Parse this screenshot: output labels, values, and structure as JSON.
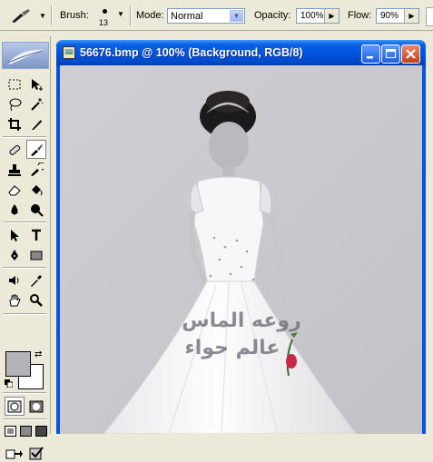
{
  "options_bar": {
    "brush_label": "Brush:",
    "brush_size": "13",
    "mode_label": "Mode:",
    "mode_value": "Normal",
    "opacity_label": "Opacity:",
    "opacity_value": "100%",
    "flow_label": "Flow:",
    "flow_value": "90%"
  },
  "toolbox": {
    "foreground_color": "#b4b4b8",
    "background_color": "#ffffff",
    "tools": [
      "marquee",
      "move",
      "lasso",
      "magic-wand",
      "crop",
      "slice",
      "healing-brush",
      "brush",
      "clone-stamp",
      "history-brush",
      "eraser",
      "paint-bucket",
      "blur",
      "dodge",
      "path-selection",
      "type",
      "pen",
      "rectangle",
      "notes",
      "eyedropper",
      "hand",
      "zoom"
    ]
  },
  "document": {
    "title": "56676.bmp @ 100% (Background, RGB/8)",
    "watermark_line1": "روعه الماس",
    "watermark_line2": "عالم حواء"
  },
  "colors": {
    "titlebar": "#0054e3",
    "canvas_bg": "#c9c8cd",
    "close_button": "#c23d16"
  }
}
